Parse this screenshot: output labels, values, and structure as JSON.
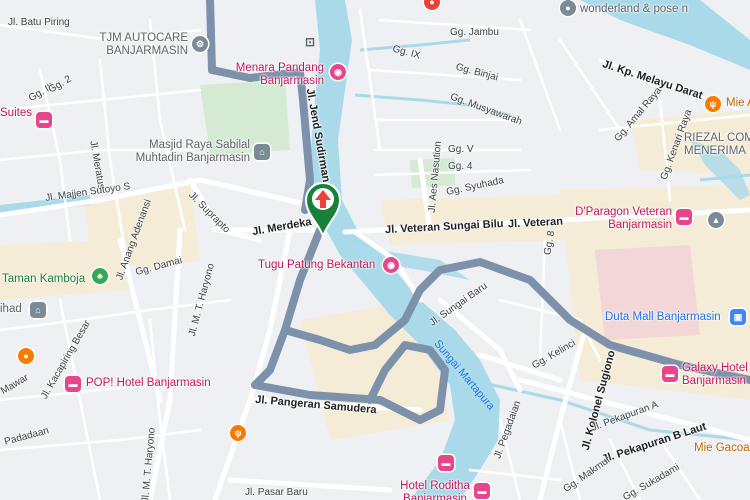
{
  "map": {
    "colors": {
      "land": "#eef0f3",
      "water": "#aadaea",
      "road": "#ffffff",
      "route": "#7d91ab",
      "commercial": "#f7edd9",
      "park": "#cfe8cf",
      "marker": "#188038",
      "marker_arrow": "#ea4335"
    },
    "streets": [
      "Jl. Batu Piring",
      "Gg. III",
      "Gg. 2",
      "Jl. Meratus",
      "Jl. Majjen Sutoyo S",
      "Jl. Suprapto",
      "Jl. Anang Adenansi",
      "Gg. Damai",
      "Jl. M. T. Haryono",
      "Jl. Kacapiring Besar",
      "Mawar",
      "Padadaan",
      "Jl. Jend Sudirman",
      "Jl. Merdeka",
      "Gg. IX",
      "Gg. Jambu",
      "Gg. Binjai",
      "Gg. Musyawarah",
      "Jl. Aes Nasution",
      "Gg. V",
      "Gg. 4",
      "Gg. Syuhada",
      "Jl. Veteran Sungai Bilu",
      "Jl. Veteran",
      "Gg. 8",
      "Jl. Sungai Baru",
      "Gg. Kelinci",
      "Jl. Kolonel Sugiono",
      "Jl. Pangeran Samudera",
      "Jl. Pegadaian",
      "Jl. Kp. Melayu Darat",
      "Gg. Amal Raya",
      "Gg. Kenari Raya",
      "Jl. Pekapuran A",
      "Jl. Pekapuran B Laut",
      "Gg. Makmur",
      "Jl. Pasar Baru",
      "Gg. Sukadami"
    ],
    "water_labels": [
      "Sungai Martapura"
    ],
    "pois": [
      {
        "name": "TJM AUTOCARE BANJARMASIN",
        "icon": "wrench-icon",
        "color": "gray"
      },
      {
        "name": "Menara Pandang Banjarmasin",
        "icon": "camera-icon",
        "color": "pink"
      },
      {
        "name": "Masjid Raya Sabilal Muhtadin Banjarmasin",
        "icon": "mosque-icon",
        "color": "gray"
      },
      {
        "name": "Taman Kamboja",
        "icon": "tree-icon",
        "color": "green"
      },
      {
        "name": "Suites",
        "icon": "bed-icon",
        "color": "pink"
      },
      {
        "name": "ihad",
        "icon": "mosque-icon",
        "color": "gray"
      },
      {
        "name": "POP! Hotel Banjarmasin",
        "icon": "bed-icon",
        "color": "pink"
      },
      {
        "name": "Tugu Patung Bekantan",
        "icon": "camera-icon",
        "color": "pink"
      },
      {
        "name": "D'Paragon Veteran Banjarmasin",
        "icon": "bed-icon",
        "color": "pink"
      },
      {
        "name": "Duta Mall Banjarmasin",
        "icon": "shopping-bag-icon",
        "color": "blue"
      },
      {
        "name": "RIEZAL COM MENERIMA",
        "icon": "",
        "color": "gray"
      },
      {
        "name": "Mie A",
        "icon": "fork-knife-icon",
        "color": "orange"
      },
      {
        "name": "Galaxy Hotel Banjarmasin",
        "icon": "bed-icon",
        "color": "pink"
      },
      {
        "name": "Hotel Roditha Banjarmasin",
        "icon": "bed-icon",
        "color": "pink"
      },
      {
        "name": "Mie Gacoa",
        "icon": "",
        "color": "orange"
      },
      {
        "name": "wonderland & pose n",
        "icon": "",
        "color": "gray"
      }
    ],
    "route_note": "navigation route highlighted",
    "current_location": {
      "icon": "navigation-arrow-icon"
    }
  }
}
